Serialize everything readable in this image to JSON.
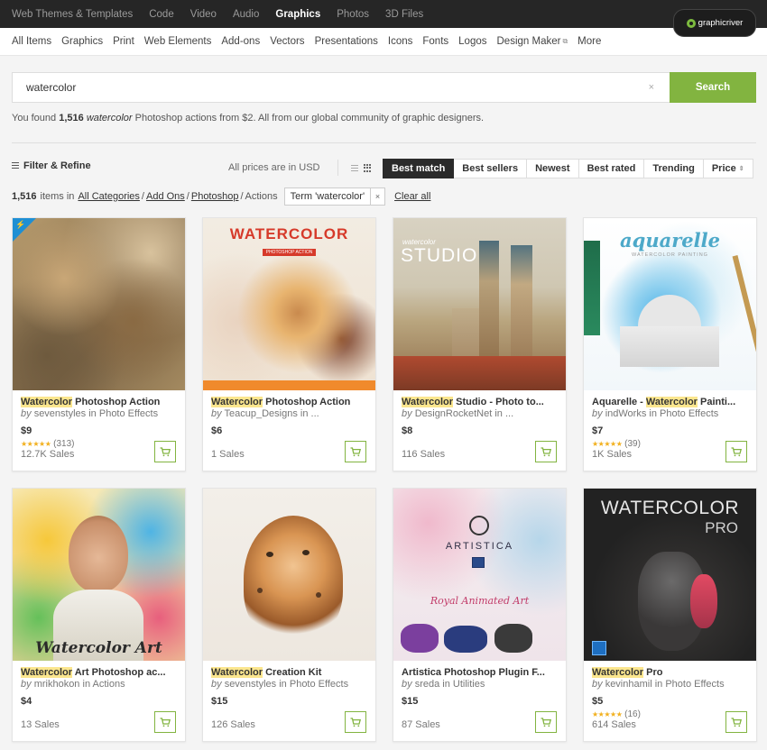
{
  "topnav": {
    "items": [
      "Web Themes & Templates",
      "Code",
      "Video",
      "Audio",
      "Graphics",
      "Photos",
      "3D Files"
    ],
    "active": "Graphics",
    "brand": "graphicriver"
  },
  "subnav": {
    "items": [
      "All Items",
      "Graphics",
      "Print",
      "Web Elements",
      "Add-ons",
      "Vectors",
      "Presentations",
      "Icons",
      "Fonts",
      "Logos",
      "Design Maker",
      "More"
    ]
  },
  "search": {
    "value": "watercolor",
    "clear": "×",
    "button": "Search"
  },
  "results": {
    "prefix": "You found",
    "count": "1,516",
    "term": "watercolor",
    "suffix": "Photoshop actions from $2. All from our global community of graphic designers."
  },
  "toolbar": {
    "filter": "Filter & Refine",
    "prices_note": "All prices are in USD",
    "sort_options": [
      "Best match",
      "Best sellers",
      "Newest",
      "Best rated",
      "Trending",
      "Price"
    ],
    "active_sort": "Best match"
  },
  "breadcrumb": {
    "count": "1,516",
    "pre": "items in",
    "links": [
      "All Categories",
      "Add Ons",
      "Photoshop"
    ],
    "current": "Actions",
    "term_chip": "Term 'watercolor'",
    "chip_x": "×",
    "clear_all": "Clear all"
  },
  "products": [
    {
      "title_hl": "Watercolor",
      "title_rest": " Photoshop Action",
      "author": "sevenstyles",
      "category": "Photo Effects",
      "price": "$9",
      "stars": "★★★★★",
      "reviews": "(313)",
      "sales": "12.7K Sales"
    },
    {
      "title_hl": "Watercolor",
      "title_rest": " Photoshop Action",
      "author": "Teacup_Designs",
      "category": "...",
      "price": "$6",
      "stars": "",
      "reviews": "",
      "sales": "1 Sales"
    },
    {
      "title_hl": "Watercolor",
      "title_rest": " Studio - Photo to...",
      "author": "DesignRocketNet",
      "category": "...",
      "price": "$8",
      "stars": "",
      "reviews": "",
      "sales": "116 Sales"
    },
    {
      "title_pre": "Aquarelle - ",
      "title_hl": "Watercolor",
      "title_rest": " Painti...",
      "author": "indWorks",
      "category": "Photo Effects",
      "price": "$7",
      "stars": "★★★★★",
      "reviews": "(39)",
      "sales": "1K Sales"
    },
    {
      "title_hl": "Watercolor",
      "title_rest": " Art Photoshop ac...",
      "author": "mrikhokon",
      "category": "Actions",
      "price": "$4",
      "stars": "",
      "reviews": "",
      "sales": "13 Sales"
    },
    {
      "title_hl": "Watercolor",
      "title_rest": " Creation Kit",
      "author": "sevenstyles",
      "category": "Photo Effects",
      "price": "$15",
      "stars": "",
      "reviews": "",
      "sales": "126 Sales"
    },
    {
      "title_pre": "Artistica Photoshop Plugin F...",
      "title_hl": "",
      "title_rest": "",
      "author": "sreda",
      "category": "Utilities",
      "price": "$15",
      "stars": "",
      "reviews": "",
      "sales": "87 Sales"
    },
    {
      "title_hl": "Watercolor",
      "title_rest": " Pro",
      "author": "kevinhamil",
      "category": "Photo Effects",
      "price": "$5",
      "stars": "★★★★★",
      "reviews": "(16)",
      "sales": "614 Sales"
    }
  ],
  "thumb_text": {
    "t2": "WATERCOLOR",
    "t2_sub": "PHOTOSHOP ACTION",
    "t3_small": "watercolor",
    "t3": "STUDIO",
    "t4": "aquarelle",
    "t4_sub": "WATERCOLOR PAINTING",
    "t5": "Watercolor Art",
    "t7": "ARTISTICA",
    "t7_sub": "Royal Animated Art",
    "t8": "WATERCOLOR",
    "t8_sub": "PRO"
  },
  "labels": {
    "by": "by",
    "in": "in"
  },
  "colors": {
    "accent": "#82b440",
    "nav_bg": "#262626",
    "highlight": "#fbe68e",
    "star": "#f2b01e"
  }
}
